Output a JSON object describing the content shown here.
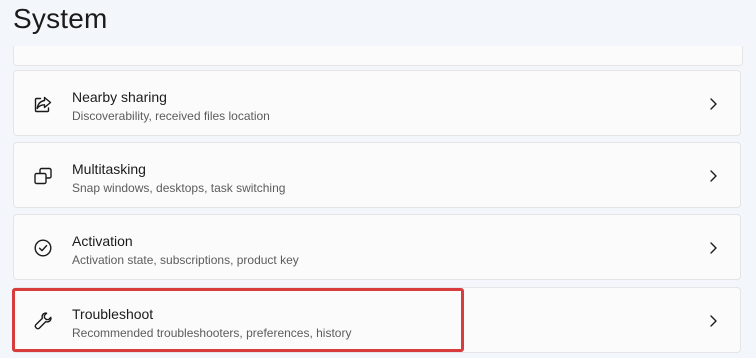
{
  "page": {
    "title": "System"
  },
  "cards": [
    {
      "title": "Nearby sharing",
      "subtitle": "Discoverability, received files location",
      "icon": "share-icon"
    },
    {
      "title": "Multitasking",
      "subtitle": "Snap windows, desktops, task switching",
      "icon": "multitasking-icon"
    },
    {
      "title": "Activation",
      "subtitle": "Activation state, subscriptions, product key",
      "icon": "activation-check-icon"
    },
    {
      "title": "Troubleshoot",
      "subtitle": "Recommended troubleshooters, preferences, history",
      "icon": "wrench-icon",
      "highlighted": true
    }
  ],
  "colors": {
    "background": "#f3f6fa",
    "card": "#fbfbfc",
    "highlight_border": "#d63c3c"
  }
}
